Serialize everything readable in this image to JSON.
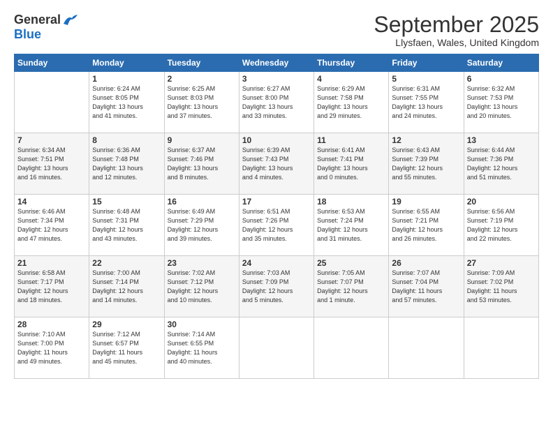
{
  "header": {
    "logo": {
      "general": "General",
      "blue": "Blue"
    },
    "title": "September 2025",
    "location": "Llysfaen, Wales, United Kingdom"
  },
  "days_of_week": [
    "Sunday",
    "Monday",
    "Tuesday",
    "Wednesday",
    "Thursday",
    "Friday",
    "Saturday"
  ],
  "weeks": [
    [
      {
        "day": "",
        "info": ""
      },
      {
        "day": "1",
        "info": "Sunrise: 6:24 AM\nSunset: 8:05 PM\nDaylight: 13 hours\nand 41 minutes."
      },
      {
        "day": "2",
        "info": "Sunrise: 6:25 AM\nSunset: 8:03 PM\nDaylight: 13 hours\nand 37 minutes."
      },
      {
        "day": "3",
        "info": "Sunrise: 6:27 AM\nSunset: 8:00 PM\nDaylight: 13 hours\nand 33 minutes."
      },
      {
        "day": "4",
        "info": "Sunrise: 6:29 AM\nSunset: 7:58 PM\nDaylight: 13 hours\nand 29 minutes."
      },
      {
        "day": "5",
        "info": "Sunrise: 6:31 AM\nSunset: 7:55 PM\nDaylight: 13 hours\nand 24 minutes."
      },
      {
        "day": "6",
        "info": "Sunrise: 6:32 AM\nSunset: 7:53 PM\nDaylight: 13 hours\nand 20 minutes."
      }
    ],
    [
      {
        "day": "7",
        "info": "Sunrise: 6:34 AM\nSunset: 7:51 PM\nDaylight: 13 hours\nand 16 minutes."
      },
      {
        "day": "8",
        "info": "Sunrise: 6:36 AM\nSunset: 7:48 PM\nDaylight: 13 hours\nand 12 minutes."
      },
      {
        "day": "9",
        "info": "Sunrise: 6:37 AM\nSunset: 7:46 PM\nDaylight: 13 hours\nand 8 minutes."
      },
      {
        "day": "10",
        "info": "Sunrise: 6:39 AM\nSunset: 7:43 PM\nDaylight: 13 hours\nand 4 minutes."
      },
      {
        "day": "11",
        "info": "Sunrise: 6:41 AM\nSunset: 7:41 PM\nDaylight: 13 hours\nand 0 minutes."
      },
      {
        "day": "12",
        "info": "Sunrise: 6:43 AM\nSunset: 7:39 PM\nDaylight: 12 hours\nand 55 minutes."
      },
      {
        "day": "13",
        "info": "Sunrise: 6:44 AM\nSunset: 7:36 PM\nDaylight: 12 hours\nand 51 minutes."
      }
    ],
    [
      {
        "day": "14",
        "info": "Sunrise: 6:46 AM\nSunset: 7:34 PM\nDaylight: 12 hours\nand 47 minutes."
      },
      {
        "day": "15",
        "info": "Sunrise: 6:48 AM\nSunset: 7:31 PM\nDaylight: 12 hours\nand 43 minutes."
      },
      {
        "day": "16",
        "info": "Sunrise: 6:49 AM\nSunset: 7:29 PM\nDaylight: 12 hours\nand 39 minutes."
      },
      {
        "day": "17",
        "info": "Sunrise: 6:51 AM\nSunset: 7:26 PM\nDaylight: 12 hours\nand 35 minutes."
      },
      {
        "day": "18",
        "info": "Sunrise: 6:53 AM\nSunset: 7:24 PM\nDaylight: 12 hours\nand 31 minutes."
      },
      {
        "day": "19",
        "info": "Sunrise: 6:55 AM\nSunset: 7:21 PM\nDaylight: 12 hours\nand 26 minutes."
      },
      {
        "day": "20",
        "info": "Sunrise: 6:56 AM\nSunset: 7:19 PM\nDaylight: 12 hours\nand 22 minutes."
      }
    ],
    [
      {
        "day": "21",
        "info": "Sunrise: 6:58 AM\nSunset: 7:17 PM\nDaylight: 12 hours\nand 18 minutes."
      },
      {
        "day": "22",
        "info": "Sunrise: 7:00 AM\nSunset: 7:14 PM\nDaylight: 12 hours\nand 14 minutes."
      },
      {
        "day": "23",
        "info": "Sunrise: 7:02 AM\nSunset: 7:12 PM\nDaylight: 12 hours\nand 10 minutes."
      },
      {
        "day": "24",
        "info": "Sunrise: 7:03 AM\nSunset: 7:09 PM\nDaylight: 12 hours\nand 5 minutes."
      },
      {
        "day": "25",
        "info": "Sunrise: 7:05 AM\nSunset: 7:07 PM\nDaylight: 12 hours\nand 1 minute."
      },
      {
        "day": "26",
        "info": "Sunrise: 7:07 AM\nSunset: 7:04 PM\nDaylight: 11 hours\nand 57 minutes."
      },
      {
        "day": "27",
        "info": "Sunrise: 7:09 AM\nSunset: 7:02 PM\nDaylight: 11 hours\nand 53 minutes."
      }
    ],
    [
      {
        "day": "28",
        "info": "Sunrise: 7:10 AM\nSunset: 7:00 PM\nDaylight: 11 hours\nand 49 minutes."
      },
      {
        "day": "29",
        "info": "Sunrise: 7:12 AM\nSunset: 6:57 PM\nDaylight: 11 hours\nand 45 minutes."
      },
      {
        "day": "30",
        "info": "Sunrise: 7:14 AM\nSunset: 6:55 PM\nDaylight: 11 hours\nand 40 minutes."
      },
      {
        "day": "",
        "info": ""
      },
      {
        "day": "",
        "info": ""
      },
      {
        "day": "",
        "info": ""
      },
      {
        "day": "",
        "info": ""
      }
    ]
  ]
}
